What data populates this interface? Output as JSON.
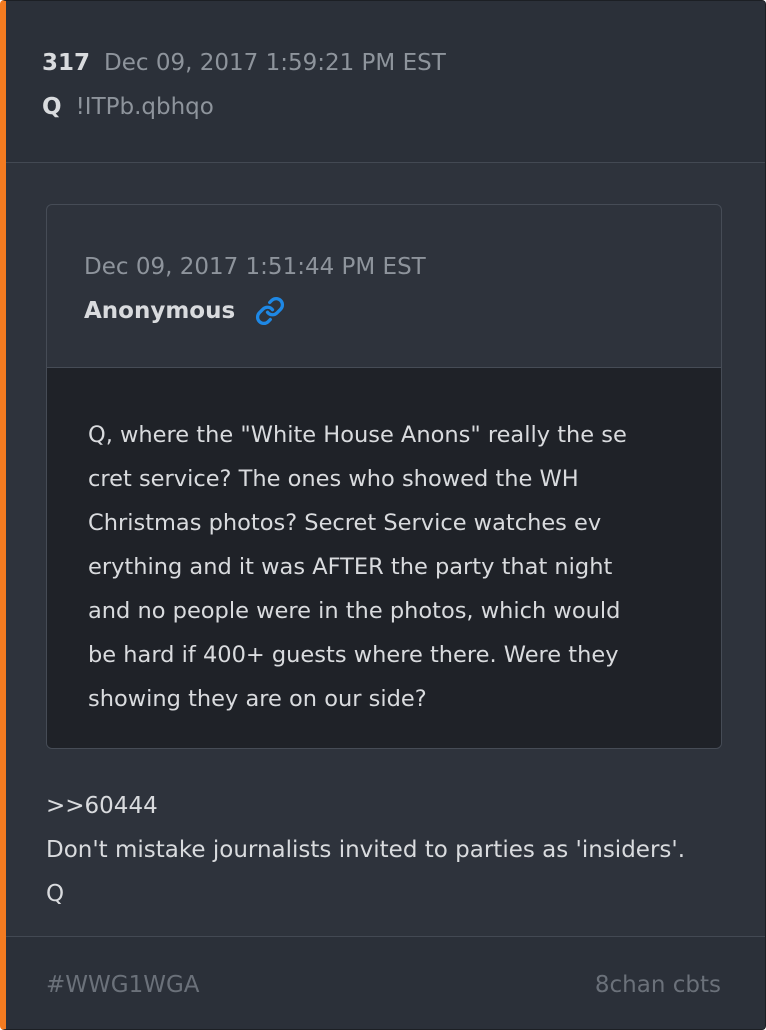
{
  "post": {
    "number": "317",
    "date": "Dec 09, 2017 1:59:21 PM EST",
    "author": "Q",
    "tripcode": "!ITPb.qbhqo"
  },
  "quoted_post": {
    "date": "Dec 09, 2017 1:51:44 PM EST",
    "author": "Anonymous",
    "link_icon": "link-icon",
    "lines": [
      "Q, where the \"White House Anons\" really the se",
      "cret service?  The ones who showed the WH",
      "Christmas photos?  Secret Service watches ev",
      "erything and it was AFTER the party that night",
      "and no people were in the photos, which would",
      "be hard if 400+ guests where there.  Were they",
      "showing they are on our side?"
    ]
  },
  "reply": {
    "lines": [
      ">>60444",
      "Don't mistake journalists invited to parties as 'insiders'.",
      "Q"
    ]
  },
  "footer": {
    "hashtag": "#WWG1WGA",
    "board": "8chan cbts"
  },
  "colors": {
    "accent_bar": "#f47b20",
    "link_icon": "#1e88e5"
  }
}
